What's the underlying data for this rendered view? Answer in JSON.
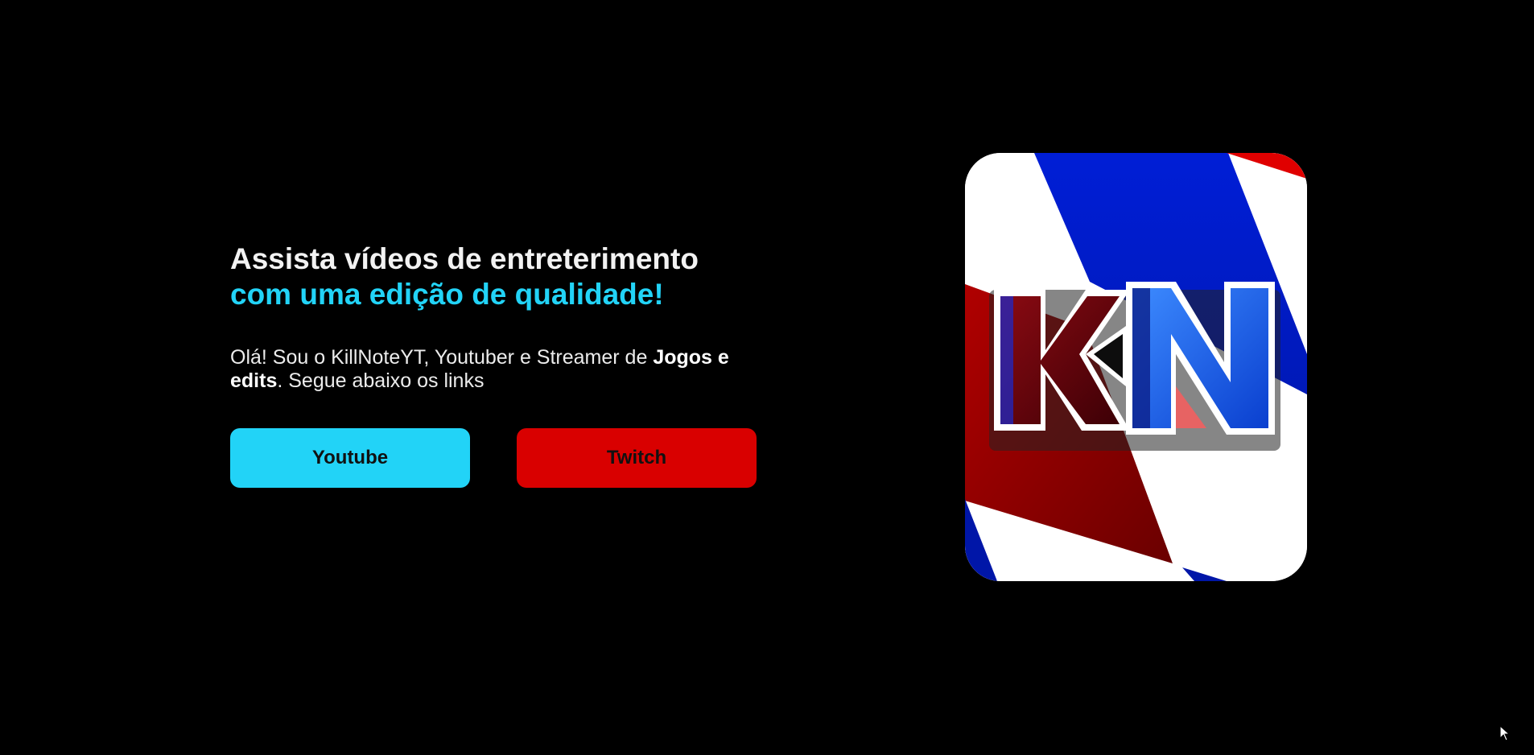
{
  "hero": {
    "headline_line1": "Assista vídeos de entreterimento",
    "headline_line2": "com uma edição de qualidade!",
    "intro_prefix": "Olá! Sou o KillNoteYT, Youtuber e Streamer de ",
    "intro_bold": "Jogos e edits",
    "intro_suffix": ". Segue abaixo os links"
  },
  "buttons": {
    "youtube_label": "Youtube",
    "twitch_label": "Twitch"
  },
  "logo": {
    "letters": "KN",
    "icon": "kn-logo-image"
  },
  "colors": {
    "background": "#000000",
    "accent_cyan": "#22d3f7",
    "accent_red": "#d90000",
    "logo_blue": "#0a1fd8",
    "logo_dark_red": "#7a0000"
  }
}
